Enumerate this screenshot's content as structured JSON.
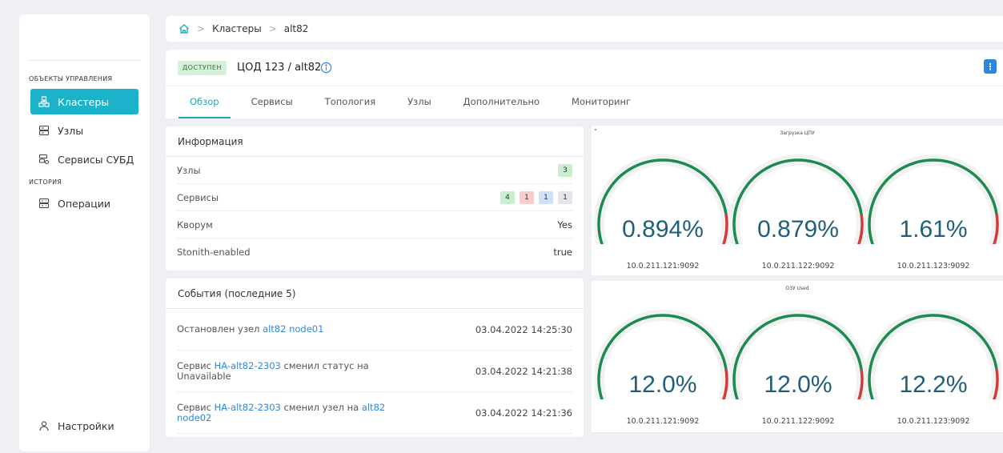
{
  "sidebar": {
    "section_objects": "ОБЪЕКТЫ УПРАВЛЕНИЯ",
    "section_history": "ИСТОРИЯ",
    "items": [
      {
        "label": "Кластеры"
      },
      {
        "label": "Узлы"
      },
      {
        "label": "Сервисы СУБД"
      },
      {
        "label": "Операции"
      }
    ],
    "settings_label": "Настройки"
  },
  "breadcrumb": {
    "items": [
      "Кластеры",
      "alt82"
    ]
  },
  "header": {
    "status": "доступен",
    "title": "ЦОД 123 / alt82",
    "kebab": "⋮",
    "tabs": [
      "Обзор",
      "Сервисы",
      "Топология",
      "Узлы",
      "Дополнительно",
      "Мониторинг"
    ]
  },
  "info": {
    "title": "Информация",
    "rows": {
      "nodes_label": "Узлы",
      "nodes_count": "3",
      "services_label": "Сервисы",
      "services_counts": [
        "4",
        "1",
        "1",
        "1"
      ],
      "quorum_label": "Кворум",
      "quorum_value": "Yes",
      "stonith_label": "Stonith-enabled",
      "stonith_value": "true"
    }
  },
  "events": {
    "title": "События (последние 5)",
    "rows": [
      {
        "prefix": "Остановлен узел ",
        "link": "alt82 node01",
        "suffix": "",
        "link2": "",
        "time": "03.04.2022 14:25:30"
      },
      {
        "prefix": "Сервис ",
        "link": "HA-alt82-2303",
        "suffix": " сменил статус на Unavailable",
        "link2": "",
        "time": "03.04.2022 14:21:38"
      },
      {
        "prefix": "Сервис ",
        "link": "HA-alt82-2303",
        "suffix": " сменил узел на ",
        "link2": "alt82 node02",
        "time": "03.04.2022 14:21:36"
      }
    ]
  },
  "monitoring": {
    "cpu": {
      "title": "Загрузка ЦПУ",
      "gauges": [
        {
          "value": "0.894%",
          "fraction": 0.0089,
          "host": "10.0.211.121:9092"
        },
        {
          "value": "0.879%",
          "fraction": 0.0088,
          "host": "10.0.211.122:9092"
        },
        {
          "value": "1.61%",
          "fraction": 0.0161,
          "host": "10.0.211.123:9092"
        }
      ]
    },
    "ram": {
      "title": "ОЗУ Used",
      "gauges": [
        {
          "value": "12.0%",
          "fraction": 0.12,
          "host": "10.0.211.121:9092"
        },
        {
          "value": "12.0%",
          "fraction": 0.12,
          "host": "10.0.211.122:9092"
        },
        {
          "value": "12.2%",
          "fraction": 0.122,
          "host": "10.0.211.123:9092"
        }
      ]
    },
    "colors": {
      "ok": "#1d8a4f",
      "warn": "#d33a3a",
      "track": "#f1f2f2",
      "value": "#1f5f7a"
    }
  },
  "colors": {
    "accent": "#1cb2c9",
    "link": "#2f86e0",
    "status_green": "#d6f0d9"
  }
}
